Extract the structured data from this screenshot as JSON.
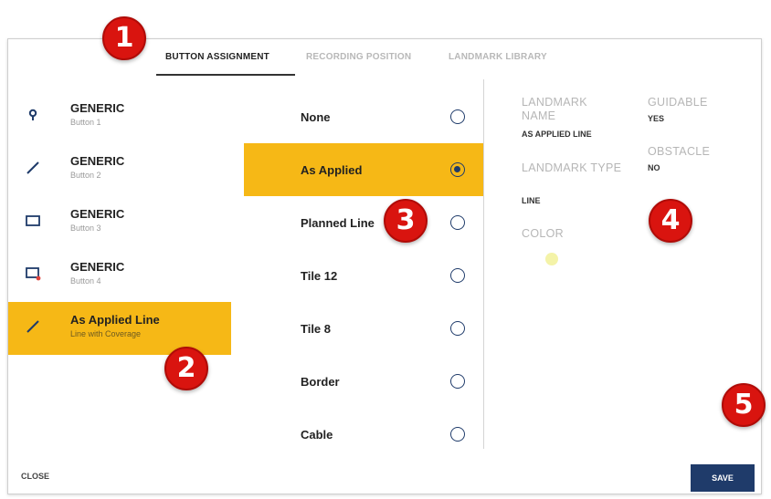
{
  "tabs": [
    {
      "label": "BUTTON ASSIGNMENT",
      "active": true
    },
    {
      "label": "RECORDING POSITION",
      "active": false
    },
    {
      "label": "LANDMARK LIBRARY",
      "active": false
    }
  ],
  "buttons": [
    {
      "title": "GENERIC",
      "subtitle": "Button 1",
      "icon": "pin-icon",
      "selected": false
    },
    {
      "title": "GENERIC",
      "subtitle": "Button 2",
      "icon": "line-icon",
      "selected": false
    },
    {
      "title": "GENERIC",
      "subtitle": "Button 3",
      "icon": "rectangle-icon",
      "selected": false
    },
    {
      "title": "GENERIC",
      "subtitle": "Button 4",
      "icon": "rectangle-corner-icon",
      "selected": false
    },
    {
      "title": "As Applied Line",
      "subtitle": "Line with Coverage",
      "icon": "line-icon",
      "selected": true
    }
  ],
  "options": [
    {
      "label": "None",
      "selected": false
    },
    {
      "label": "As Applied",
      "selected": true
    },
    {
      "label": "Planned Line",
      "selected": false
    },
    {
      "label": "Tile 12",
      "selected": false
    },
    {
      "label": "Tile 8",
      "selected": false
    },
    {
      "label": "Border",
      "selected": false
    },
    {
      "label": "Cable",
      "selected": false
    }
  ],
  "details": {
    "landmark_name_label": "LANDMARK NAME",
    "landmark_name_value": "AS APPLIED LINE",
    "landmark_type_label": "LANDMARK TYPE",
    "landmark_type_value": "LINE",
    "color_label": "COLOR",
    "color_value": "#f4f3a8",
    "guidable_label": "GUIDABLE",
    "guidable_value": "YES",
    "obstacle_label": "OBSTACLE",
    "obstacle_value": "NO"
  },
  "footer": {
    "close_label": "CLOSE",
    "save_label": "SAVE"
  },
  "callouts": [
    "1",
    "2",
    "3",
    "4",
    "5"
  ],
  "colors": {
    "accent": "#f6b816",
    "primary": "#1f3b6a",
    "callout": "#d9140f"
  }
}
